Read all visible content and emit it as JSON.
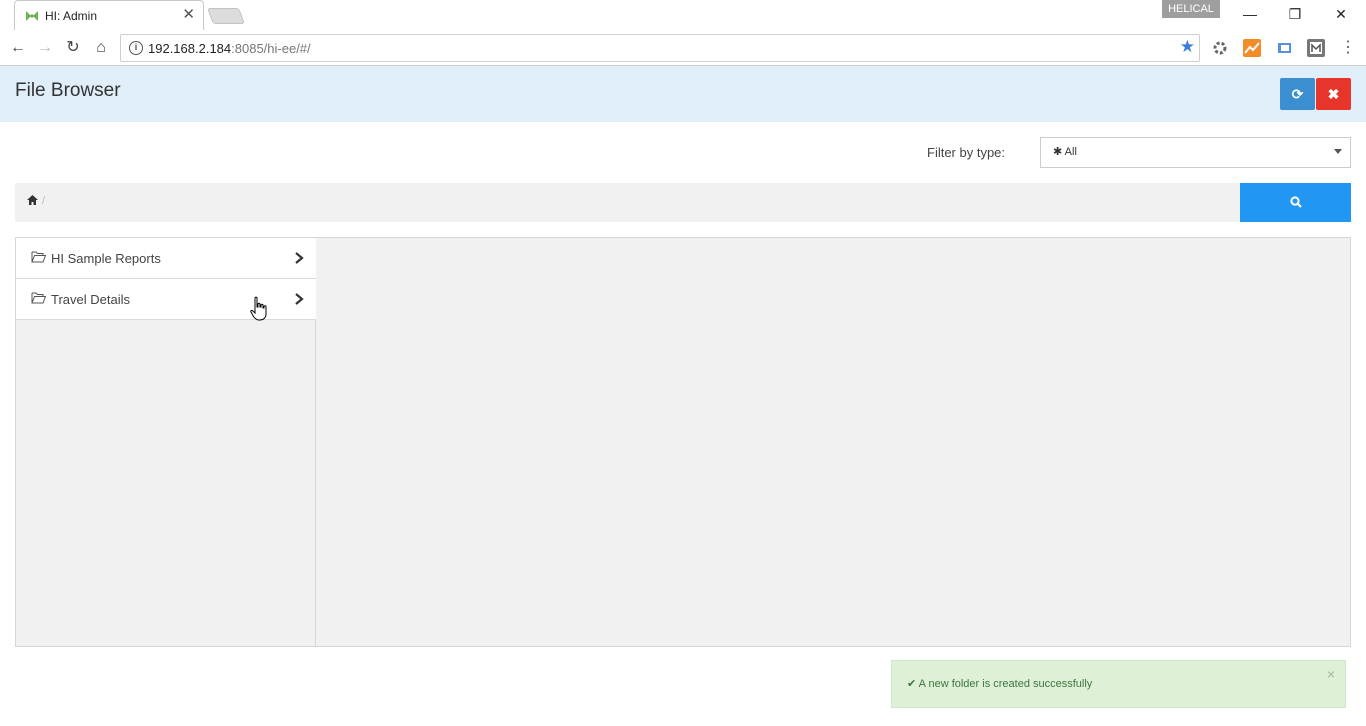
{
  "browser": {
    "tab_title": "HI: Admin",
    "tab_close": "✕",
    "profile_name": "HELICAL",
    "window_controls": {
      "minimize": "—",
      "restore": "❐",
      "close": "✕"
    },
    "nav": {
      "back": "←",
      "forward": "→",
      "reload": "↻",
      "home": "⌂"
    },
    "url_host": "192.168.2.184",
    "url_rest": ":8085/hi-ee/#/",
    "info_glyph": "i",
    "bookmark_glyph": "★",
    "menu_glyph": "⋮"
  },
  "header": {
    "title": "File Browser",
    "refresh_glyph": "⟳",
    "close_glyph": "✖"
  },
  "filter": {
    "label": "Filter by type:",
    "selected": "✱ All"
  },
  "breadcrumb": {
    "home_glyph": "⌂",
    "separator": "/"
  },
  "search": {
    "glyph": "⚲"
  },
  "folders": [
    {
      "name": "HI Sample Reports"
    },
    {
      "name": "Travel Details"
    }
  ],
  "notification": {
    "message": "✔ A new folder is created successfully",
    "dismiss": "×"
  },
  "colors": {
    "header_bg": "#dfeef8",
    "refresh_button": "#3b8ed0",
    "close_button": "#e8352b",
    "search_button": "#2196f3",
    "toast_bg": "#dff0d8",
    "toast_text": "#3c763d"
  }
}
